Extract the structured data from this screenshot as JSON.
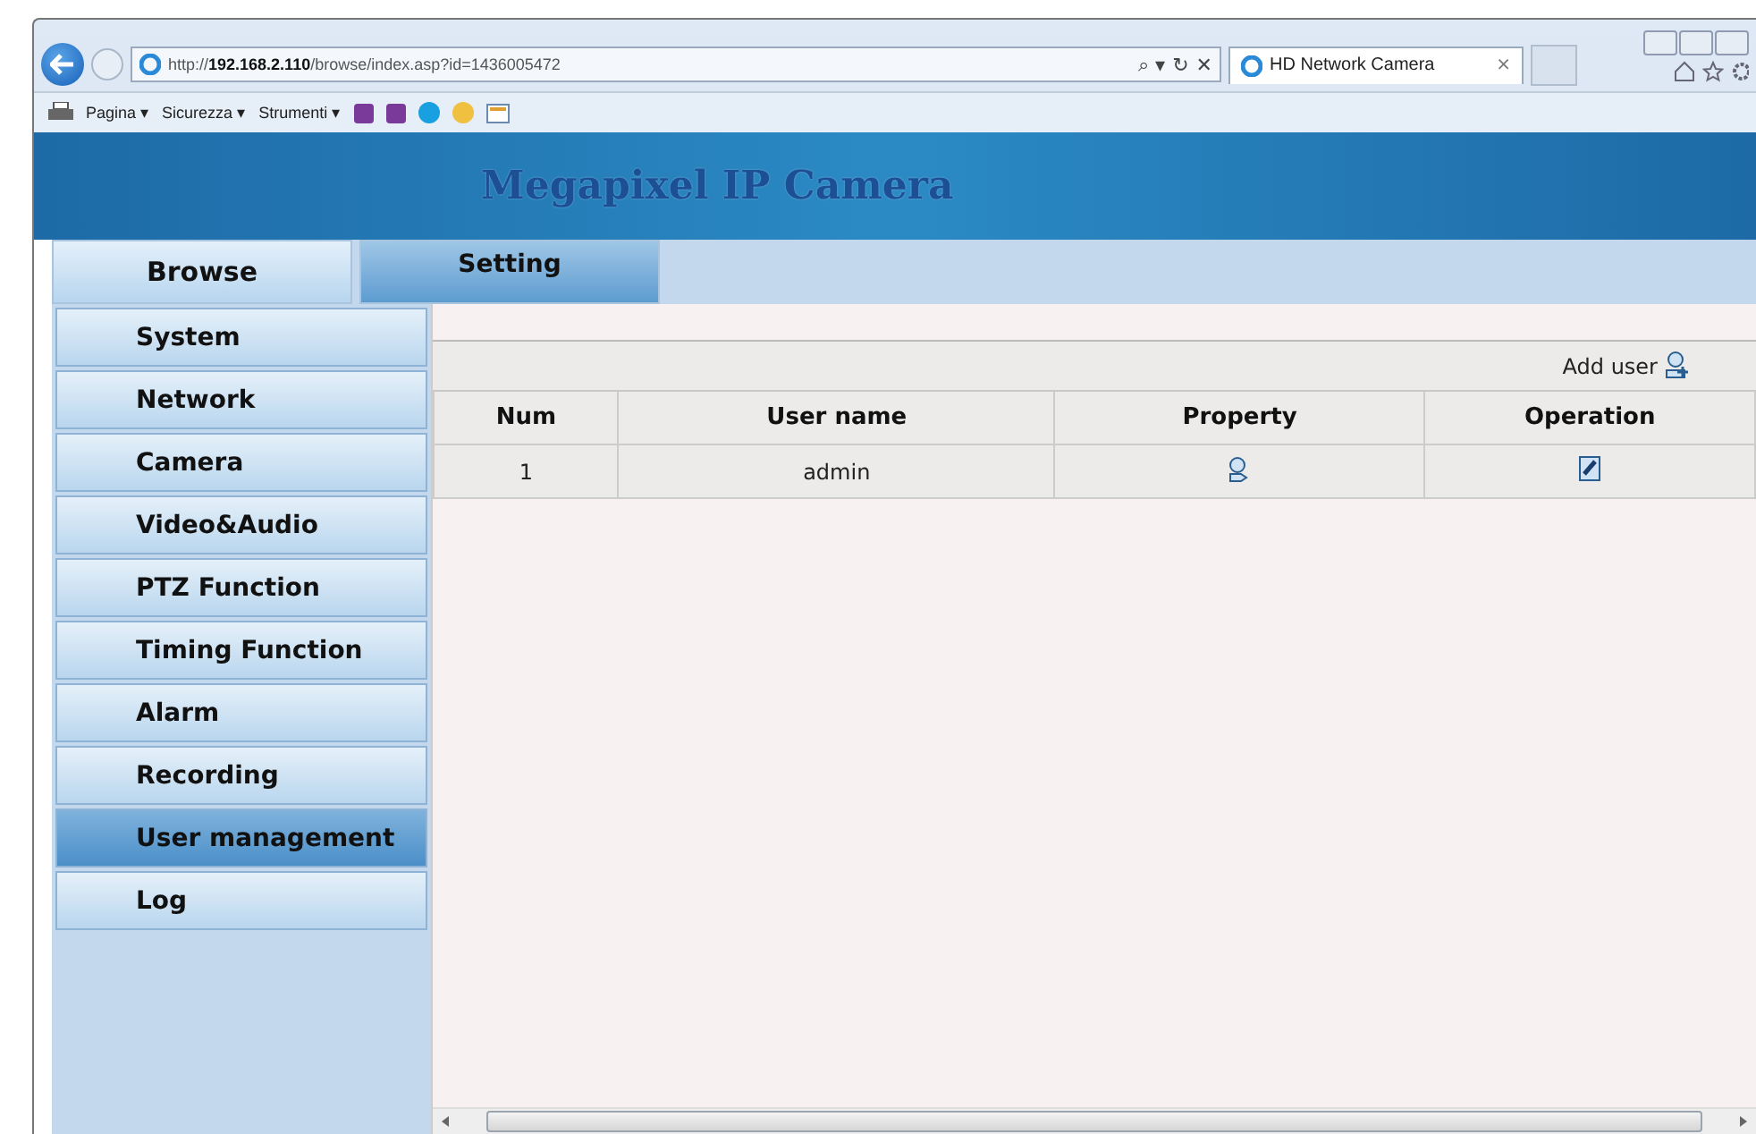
{
  "browser": {
    "url_prefix": "http://",
    "url_host": "192.168.2.110",
    "url_path": "/browse/index.asp?id=1436005472",
    "tab_title": "HD Network Camera",
    "tab_close": "×",
    "address_buttons": [
      "⌕ ▾",
      "↻",
      "✕"
    ],
    "command_bar": [
      {
        "kind": "printer"
      },
      {
        "kind": "menu",
        "label": "Pagina ▾"
      },
      {
        "kind": "menu",
        "label": "Sicurezza ▾"
      },
      {
        "kind": "menu",
        "label": "Strumenti ▾"
      },
      {
        "kind": "onenote"
      },
      {
        "kind": "onenote"
      },
      {
        "kind": "skype"
      },
      {
        "kind": "smiley"
      },
      {
        "kind": "panel"
      }
    ]
  },
  "banner": {
    "title": "Megapixel IP Camera"
  },
  "top_tabs": [
    {
      "label": "Browse",
      "selected": false
    },
    {
      "label": "Setting",
      "selected": true
    }
  ],
  "sidebar": {
    "items": [
      {
        "label": "System",
        "selected": false
      },
      {
        "label": "Network",
        "selected": false
      },
      {
        "label": "Camera",
        "selected": false
      },
      {
        "label": "Video&Audio",
        "selected": false
      },
      {
        "label": "PTZ Function",
        "selected": false
      },
      {
        "label": "Timing Function",
        "selected": false
      },
      {
        "label": "Alarm",
        "selected": false
      },
      {
        "label": "Recording",
        "selected": false
      },
      {
        "label": "User management",
        "selected": true
      },
      {
        "label": "Log",
        "selected": false
      }
    ]
  },
  "users": {
    "add_label": "Add user",
    "columns": [
      "Num",
      "User name",
      "Property",
      "Operation"
    ],
    "rows": [
      {
        "num": "1",
        "name": "admin"
      }
    ]
  }
}
